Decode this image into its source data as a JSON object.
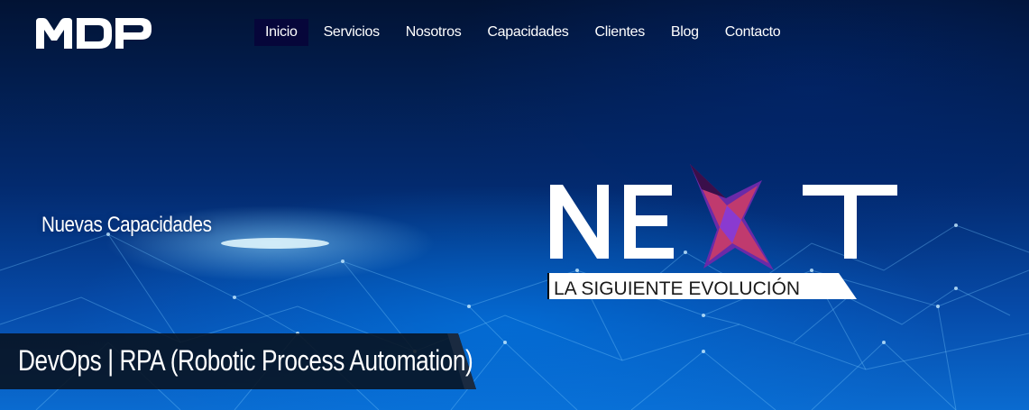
{
  "brand": {
    "logo_text": "MDP"
  },
  "nav": {
    "items": [
      {
        "label": "Inicio",
        "active": true
      },
      {
        "label": "Servicios",
        "active": false
      },
      {
        "label": "Nosotros",
        "active": false
      },
      {
        "label": "Capacidades",
        "active": false
      },
      {
        "label": "Clientes",
        "active": false
      },
      {
        "label": "Blog",
        "active": false
      },
      {
        "label": "Contacto",
        "active": false
      }
    ]
  },
  "hero": {
    "tagline": "Nuevas Capacidades",
    "logo_word": "NEXT",
    "logo_subtitle": "LA SIGUIENTE EVOLUCIÓN",
    "banner": "DevOps | RPA (Robotic Process Automation)"
  },
  "colors": {
    "nav_active_bg": "#06063a",
    "banner_bg": "#08111e",
    "x_mark_primary": "#c03a6e",
    "x_mark_secondary": "#6a2aa8"
  }
}
